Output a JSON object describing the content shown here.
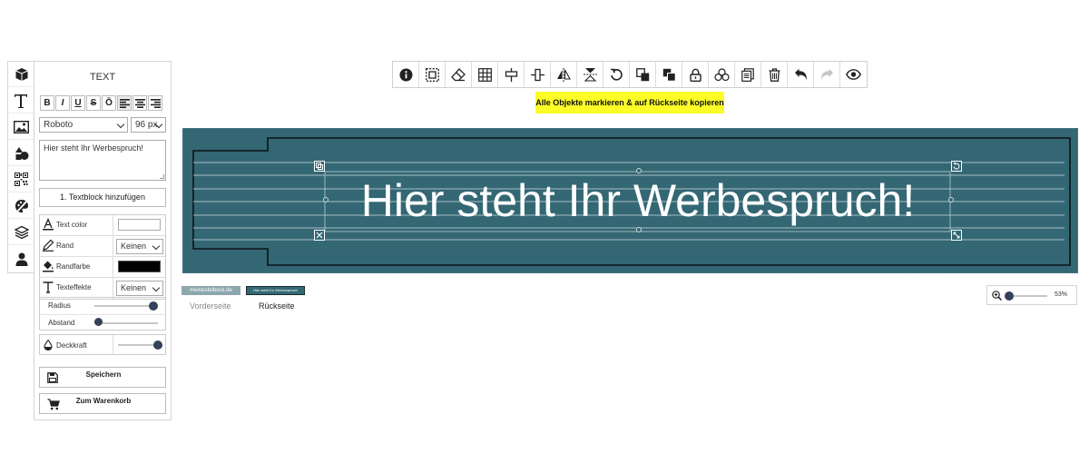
{
  "panel": {
    "title": "TEXT",
    "format_buttons": [
      "B",
      "I",
      "U",
      "S",
      "Ō"
    ],
    "font_family": "Roboto",
    "font_size": "96 px",
    "text_value": "Hier steht Ihr Werbespruch!",
    "add_textblock_label": "1. Textblock hinzufügen",
    "text_color_label": "Text color",
    "border_label": "Rand",
    "border_value": "Keinen",
    "border_color_label": "Randfarbe",
    "effects_label": "Texteffekte",
    "effects_value": "Keinen",
    "radius_label": "Radius",
    "radius_value": 1.0,
    "spacing_label": "Abstand",
    "spacing_value": 0.0,
    "opacity_label": "Deckkraft",
    "opacity_value": 1.0,
    "save_label": "Speichern",
    "cart_label": "Zum Warenkorb"
  },
  "tooltip": {
    "text": "Alle Objekte markieren & auf Rückseite kopieren"
  },
  "canvas": {
    "text": "Hier steht Ihr Werbespruch!",
    "background_color": "#346774"
  },
  "pages": {
    "front_label": "Vorderseite",
    "back_label": "Rückseite",
    "front_thumb_text": "meinestelbock.de",
    "back_thumb_text": "Hier steht Ihr Werbespruch!"
  },
  "zoom": {
    "value": "53%"
  },
  "icons": {
    "toolbar": [
      "info-icon",
      "select-all-icon",
      "eraser-icon",
      "grid-icon",
      "center-horizontal-icon",
      "center-vertical-icon",
      "flip-horizontal-icon",
      "flip-vertical-icon",
      "rotate-icon",
      "bring-forward-icon",
      "send-backward-icon",
      "lock-icon",
      "group-icon",
      "copy-icon",
      "trash-icon",
      "undo-icon",
      "redo-icon",
      "preview-eye-icon"
    ]
  },
  "colors": {
    "accent_dark": "#33415a",
    "tooltip": "#fcfc27",
    "canvas_bg": "#346774"
  }
}
